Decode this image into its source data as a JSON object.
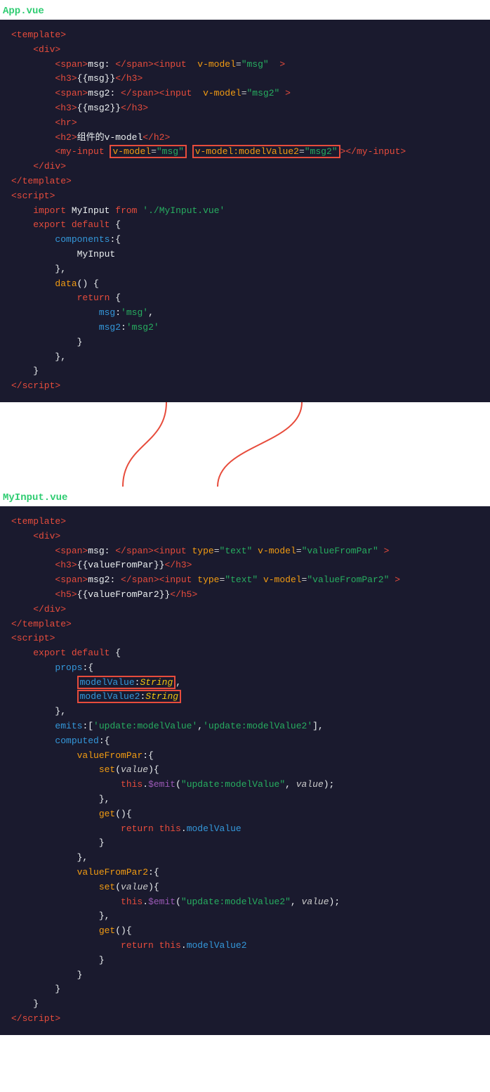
{
  "app_file": {
    "label": "App.vue",
    "lines": []
  },
  "myinput_file": {
    "label": "MyInput.vue",
    "lines": []
  }
}
